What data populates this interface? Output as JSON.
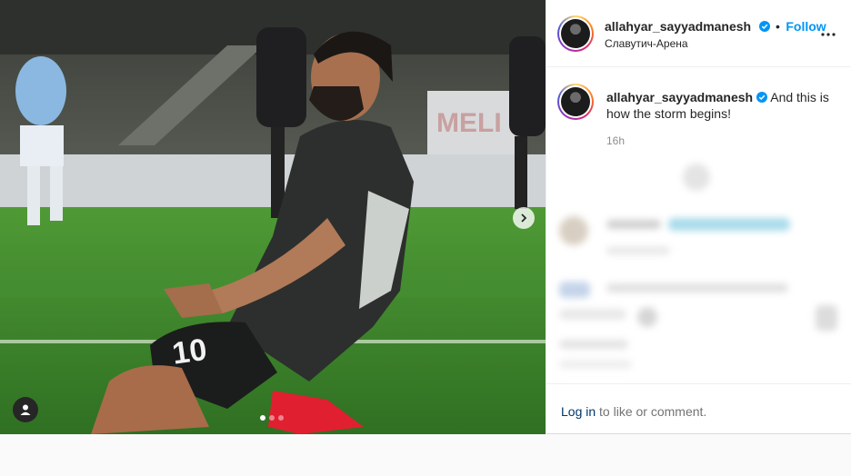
{
  "post": {
    "username": "allahyar_sayyadmanesh",
    "follow_label": "Follow",
    "location": "Славутич-Арена",
    "caption_username": "allahyar_sayyadmanesh",
    "caption_text": "And this is how the storm begins!",
    "timestamp": "16h",
    "jersey_number": "10",
    "login_link": "Log in",
    "login_rest": " to like or comment."
  },
  "carousel": {
    "current": 1,
    "total": 3
  },
  "colors": {
    "follow": "#0095f6",
    "link": "#00376b",
    "pitch": "#3f8a2c"
  },
  "icons": [
    "verified-badge-icon",
    "more-options-icon",
    "chevron-right-icon",
    "user-tag-icon"
  ]
}
